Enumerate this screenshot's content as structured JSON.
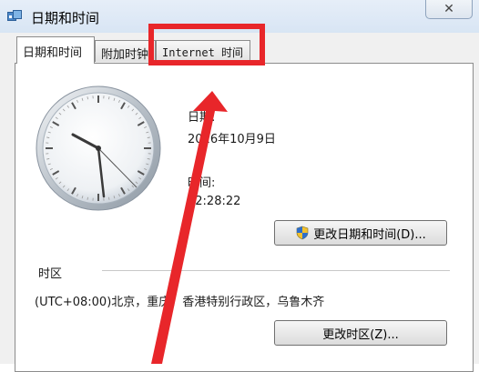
{
  "window": {
    "title": "日期和时间",
    "close_symbol": "✕"
  },
  "tabs": [
    {
      "label": "日期和时间",
      "active": true
    },
    {
      "label": "附加时钟",
      "active": false
    },
    {
      "label": "Internet 时间",
      "active": false
    }
  ],
  "date_time": {
    "date_label": "日期:",
    "date_value": "2016年10月9日",
    "time_label": "时间:",
    "time_value": "22:28:22",
    "change_button": "更改日期和时间(D)..."
  },
  "timezone": {
    "section_label": "时区",
    "value": "(UTC+08:00)北京，重庆，香港特别行政区，乌鲁木齐",
    "change_button": "更改时区(Z)..."
  },
  "annotation": {
    "color": "#e8262a"
  }
}
